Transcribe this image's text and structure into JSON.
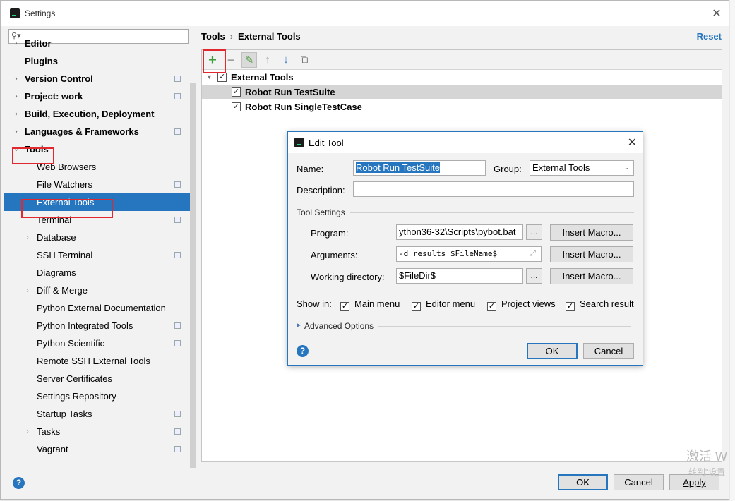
{
  "window": {
    "title": "Settings",
    "close_glyph": "✕"
  },
  "search": {
    "placeholder": ""
  },
  "tree": [
    {
      "label": "Editor",
      "bold": true,
      "arrow": "›",
      "level": 0,
      "copy": false
    },
    {
      "label": "Plugins",
      "bold": true,
      "arrow": "",
      "level": 0,
      "copy": false
    },
    {
      "label": "Version Control",
      "bold": true,
      "arrow": "›",
      "level": 0,
      "copy": true
    },
    {
      "label": "Project: work",
      "bold": true,
      "arrow": "›",
      "level": 0,
      "copy": true
    },
    {
      "label": "Build, Execution, Deployment",
      "bold": true,
      "arrow": "›",
      "level": 0,
      "copy": false
    },
    {
      "label": "Languages & Frameworks",
      "bold": true,
      "arrow": "›",
      "level": 0,
      "copy": true
    },
    {
      "label": "Tools",
      "bold": true,
      "arrow": "⌄",
      "level": 0,
      "copy": false
    },
    {
      "label": "Web Browsers",
      "bold": false,
      "arrow": "",
      "level": 1,
      "copy": false
    },
    {
      "label": "File Watchers",
      "bold": false,
      "arrow": "",
      "level": 1,
      "copy": true
    },
    {
      "label": "External Tools",
      "bold": false,
      "arrow": "",
      "level": 1,
      "copy": false,
      "selected": true
    },
    {
      "label": "Terminal",
      "bold": false,
      "arrow": "",
      "level": 1,
      "copy": true
    },
    {
      "label": "Database",
      "bold": false,
      "arrow": "›",
      "level": 1,
      "copy": false
    },
    {
      "label": "SSH Terminal",
      "bold": false,
      "arrow": "",
      "level": 1,
      "copy": true
    },
    {
      "label": "Diagrams",
      "bold": false,
      "arrow": "",
      "level": 1,
      "copy": false
    },
    {
      "label": "Diff & Merge",
      "bold": false,
      "arrow": "›",
      "level": 1,
      "copy": false
    },
    {
      "label": "Python External Documentation",
      "bold": false,
      "arrow": "",
      "level": 1,
      "copy": false
    },
    {
      "label": "Python Integrated Tools",
      "bold": false,
      "arrow": "",
      "level": 1,
      "copy": true
    },
    {
      "label": "Python Scientific",
      "bold": false,
      "arrow": "",
      "level": 1,
      "copy": true
    },
    {
      "label": "Remote SSH External Tools",
      "bold": false,
      "arrow": "",
      "level": 1,
      "copy": false
    },
    {
      "label": "Server Certificates",
      "bold": false,
      "arrow": "",
      "level": 1,
      "copy": false
    },
    {
      "label": "Settings Repository",
      "bold": false,
      "arrow": "",
      "level": 1,
      "copy": false
    },
    {
      "label": "Startup Tasks",
      "bold": false,
      "arrow": "",
      "level": 1,
      "copy": true
    },
    {
      "label": "Tasks",
      "bold": false,
      "arrow": "›",
      "level": 1,
      "copy": true
    },
    {
      "label": "Vagrant",
      "bold": false,
      "arrow": "",
      "level": 1,
      "copy": true
    }
  ],
  "breadcrumb": {
    "parent": "Tools",
    "separator": "›",
    "current": "External Tools"
  },
  "reset_label": "Reset",
  "toolbar": {
    "add_glyph": "+",
    "remove_glyph": "−",
    "edit_glyph": "✎",
    "up_glyph": "↑",
    "down_glyph": "↓",
    "copy_glyph": "⧉"
  },
  "tools_list": {
    "group": "External Tools",
    "items": [
      "Robot Run TestSuite",
      "Robot Run SingleTestCase"
    ],
    "check_glyph": "✓"
  },
  "footer": {
    "help": "?",
    "ok": "OK",
    "cancel": "Cancel",
    "apply": "Apply"
  },
  "dialog": {
    "title": "Edit Tool",
    "close_glyph": "✕",
    "name_label": "Name:",
    "name_value": "Robot Run TestSuite",
    "group_label": "Group:",
    "group_value": "External Tools",
    "description_label": "Description:",
    "description_value": "",
    "tool_settings_label": "Tool Settings",
    "program_label": "Program:",
    "program_value": "ython36-32\\Scripts\\pybot.bat",
    "arguments_label": "Arguments:",
    "arguments_value": "-d results $FileName$",
    "workdir_label": "Working directory:",
    "workdir_value": "$FileDir$",
    "dots": "...",
    "insert_macro": "Insert Macro...",
    "show_in_label": "Show in:",
    "show_in": [
      "Main menu",
      "Editor menu",
      "Project views",
      "Search result"
    ],
    "advanced_label": "Advanced Options",
    "ok": "OK",
    "cancel": "Cancel",
    "help": "?"
  },
  "watermark": {
    "line1": "激活 W",
    "line2": "转到\"设置"
  },
  "colors": {
    "accent": "#2675bf",
    "highlight_red": "#e0282e",
    "add_green": "#3a9c3a"
  }
}
